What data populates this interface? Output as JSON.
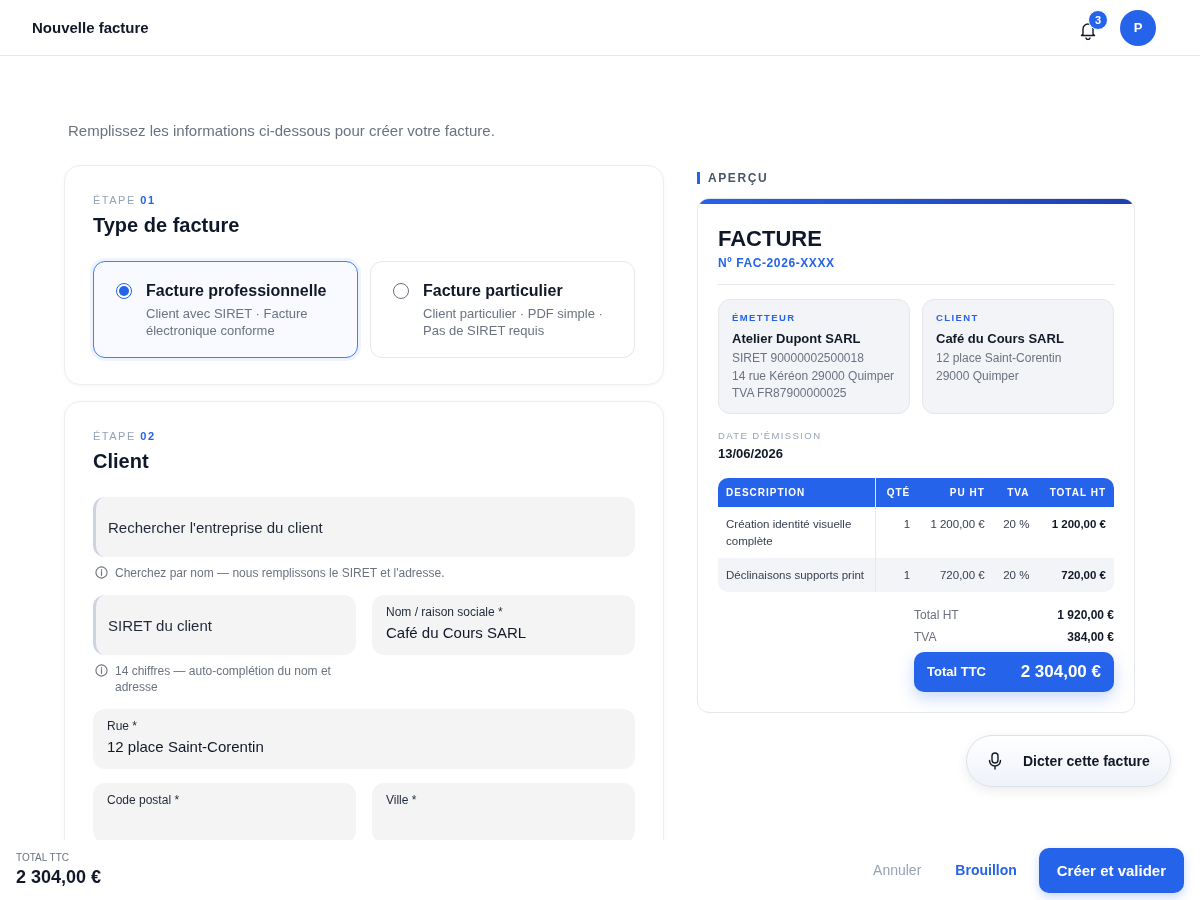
{
  "header": {
    "title": "Nouvelle facture",
    "notifications": "3",
    "avatar": "P"
  },
  "intro": "Remplissez les informations ci-dessous pour créer votre facture.",
  "step1": {
    "step_label": "ÉTAPE",
    "step_number": "01",
    "title": "Type de facture",
    "options": [
      {
        "title": "Facture professionnelle",
        "description": "Client avec SIRET · Facture électronique conforme",
        "selected": true
      },
      {
        "title": "Facture particulier",
        "description": "Client particulier · PDF simple · Pas de SIRET requis",
        "selected": false
      }
    ]
  },
  "step2": {
    "step_label": "ÉTAPE",
    "step_number": "02",
    "title": "Client",
    "rows": [
      [
        {
          "kind": "search",
          "placeholder": "Rechercher l'entreprise du client",
          "hint": "Cherchez par nom — nous remplissons le SIRET et l'adresse."
        }
      ],
      [
        {
          "kind": "search",
          "placeholder": "SIRET du client",
          "hint": "14 chiffres — auto-complétion du nom et adresse"
        },
        {
          "kind": "filled",
          "label": "Nom / raison sociale *",
          "value": "Café du Cours SARL"
        }
      ],
      [
        {
          "kind": "filled",
          "label": "Rue *",
          "value": "12 place Saint-Corentin"
        }
      ],
      [
        {
          "kind": "filled",
          "label": "Code postal *"
        },
        {
          "kind": "filled",
          "label": "Ville *"
        }
      ]
    ]
  },
  "preview": {
    "heading": "APERÇU",
    "title": "FACTURE",
    "number": "Nº FAC-2026-XXXX",
    "parties": [
      {
        "role": "ÉMETTEUR",
        "name": "Atelier Dupont SARL",
        "lines": [
          "SIRET 90000002500018",
          "14 rue Kéréon 29000 Quimper",
          "TVA FR87900000025"
        ]
      },
      {
        "role": "CLIENT",
        "name": "Café du Cours SARL",
        "lines": [
          "12 place Saint-Corentin",
          "29000 Quimper"
        ]
      }
    ],
    "date_label": "DATE D'ÉMISSION",
    "date": "13/06/2026",
    "table": {
      "columns": [
        "DESCRIPTION",
        "QTÉ",
        "PU HT",
        "TVA",
        "TOTAL HT"
      ],
      "rows": [
        [
          "Création identité visuelle complète",
          "1",
          "1 200,00 €",
          "20 %",
          "1 200,00 €"
        ],
        [
          "Déclinaisons supports print",
          "1",
          "720,00 €",
          "20 %",
          "720,00 €"
        ]
      ]
    },
    "totals": [
      {
        "label": "Total HT",
        "value": "1 920,00 €"
      },
      {
        "label": "TVA",
        "value": "384,00 €"
      }
    ],
    "grand_total": {
      "label": "Total TTC",
      "value": "2 304,00 €"
    }
  },
  "dictate_button": "Dicter cette facture",
  "footer": {
    "total_label": "TOTAL TTC",
    "total": "2 304,00 €",
    "buttons": [
      {
        "label": "Annuler",
        "kind": "muted"
      },
      {
        "label": "Brouillon",
        "kind": "link"
      },
      {
        "label": "Créer et valider",
        "kind": "primary"
      }
    ]
  }
}
